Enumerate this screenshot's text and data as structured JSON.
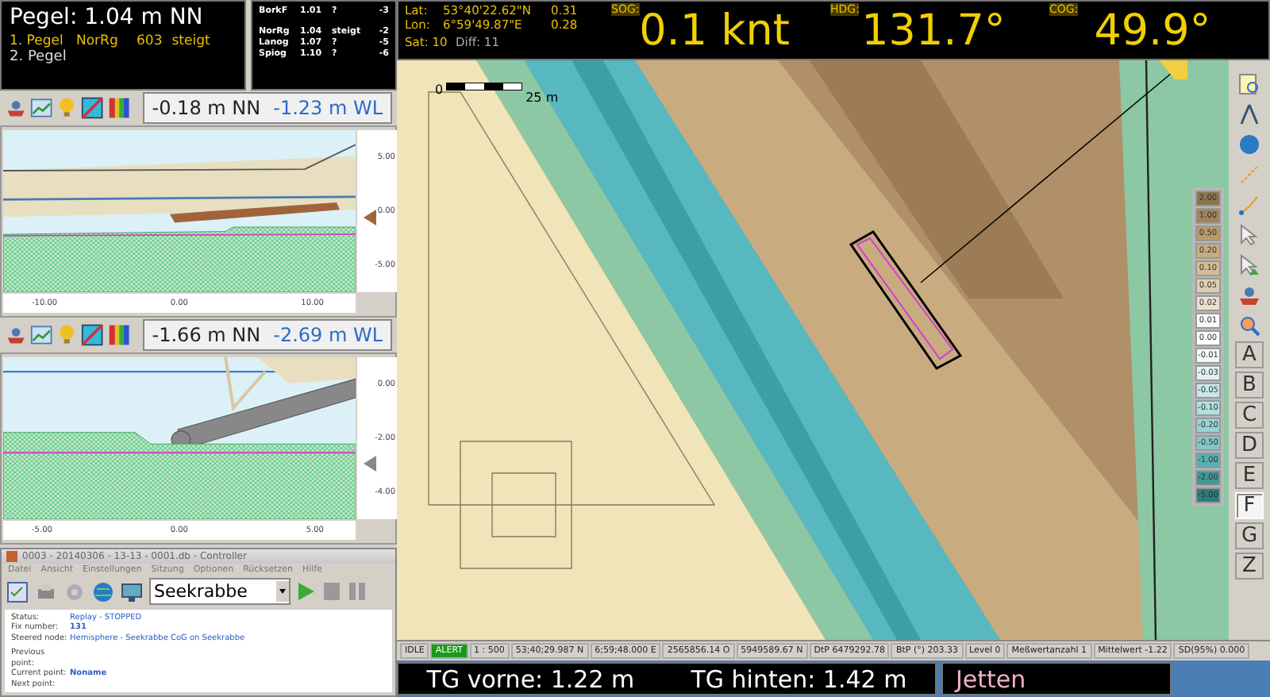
{
  "water_level": {
    "title": "Pegel: 1.04 m NN",
    "gauges": [
      {
        "label": "1. Pegel",
        "station": "NorRg",
        "value": "603",
        "trend": "steigt"
      },
      {
        "label": "2. Pegel"
      }
    ]
  },
  "gauge_groups": [
    [
      {
        "station": "BorkF",
        "level": "1.01",
        "trend": "?",
        "delta": "-3"
      }
    ],
    [
      {
        "station": "NorRg",
        "level": "1.04",
        "trend": "steigt",
        "delta": "-2"
      },
      {
        "station": "Lanog",
        "level": "1.07",
        "trend": "?",
        "delta": "-5"
      },
      {
        "station": "Spiog",
        "level": "1.10",
        "trend": "?",
        "delta": "-6"
      }
    ]
  ],
  "gps": {
    "lat_label": "Lat:",
    "lat": "53°40'22.62\"N",
    "lat_extra": "0.31",
    "lon_label": "Lon:",
    "lon": "6°59'49.87\"E",
    "lon_extra": "0.28",
    "sat": "Sat: 10",
    "diff": "Diff: 11"
  },
  "readouts": [
    {
      "label": "SOG:",
      "value": "0.1 knt"
    },
    {
      "label": "HDG:",
      "value": "131.7°"
    },
    {
      "label": "COG:",
      "value": "49.9°"
    }
  ],
  "profiles": [
    {
      "kind": "railing",
      "nn": "-0.18 m NN",
      "wl": "-1.23 m WL",
      "y_ticks": [
        "5.00",
        "0.00",
        "-5.00"
      ],
      "x_ticks": [
        "-10.00",
        "0.00",
        "10.00"
      ]
    },
    {
      "kind": "pipe",
      "nn": "-1.66 m NN",
      "wl": "-2.69 m WL",
      "y_ticks": [
        "0.00",
        "-2.00",
        "-4.00"
      ],
      "x_ticks": [
        "-5.00",
        "0.00",
        "5.00"
      ]
    }
  ],
  "controller": {
    "title": "0003 - 20140306 - 13-13 - 0001.db - Controller",
    "menu": [
      "Datei",
      "Ansicht",
      "Einstellungen",
      "Sitzung",
      "Optionen",
      "Rücksetzen",
      "Hilfe"
    ],
    "vessel": "Seekrabbe",
    "info": [
      {
        "label": "Status:",
        "value": "Replay - STOPPED"
      },
      {
        "label": "Fix number:",
        "value": "131"
      },
      {
        "label": "Steered node:",
        "value": "Hemisphere - Seekrabbe CoG on Seekrabbe"
      }
    ],
    "points": [
      {
        "label": "Previous point:"
      },
      {
        "label": "Current point:",
        "value": "Noname"
      },
      {
        "label": "Next point:"
      }
    ]
  },
  "map": {
    "scale_start": "0",
    "scale_end": "25 m"
  },
  "depth_legend": [
    {
      "value": "2.00",
      "color": "#8c7450"
    },
    {
      "value": "1.00",
      "color": "#a08458"
    },
    {
      "value": "0.50",
      "color": "#b89a68"
    },
    {
      "value": "0.20",
      "color": "#c8ac80"
    },
    {
      "value": "0.10",
      "color": "#d4bc94"
    },
    {
      "value": "0.05",
      "color": "#e0ceb0"
    },
    {
      "value": "0.02",
      "color": "#ece0cc"
    },
    {
      "value": "0.01",
      "color": "#fafafa"
    },
    {
      "value": "0.00",
      "color": "#ffffff"
    },
    {
      "value": "-0.01",
      "color": "#f4fafa"
    },
    {
      "value": "-0.03",
      "color": "#e0f2f2"
    },
    {
      "value": "-0.05",
      "color": "#c8e8e8"
    },
    {
      "value": "-0.10",
      "color": "#b0e0e0"
    },
    {
      "value": "-0.20",
      "color": "#98d4d4"
    },
    {
      "value": "-0.50",
      "color": "#80c8c8"
    },
    {
      "value": "-1.00",
      "color": "#58b0b0"
    },
    {
      "value": "-2.00",
      "color": "#409898"
    },
    {
      "value": "-5.00",
      "color": "#2c7c7c"
    }
  ],
  "letters": [
    {
      "label": "A",
      "selected": false
    },
    {
      "label": "B",
      "selected": false
    },
    {
      "label": "C",
      "selected": false
    },
    {
      "label": "D",
      "selected": false
    },
    {
      "label": "E",
      "selected": false
    },
    {
      "label": "F",
      "selected": true
    },
    {
      "label": "G",
      "selected": false
    },
    {
      "label": "Z",
      "selected": false
    }
  ],
  "status_bar": [
    {
      "text": "IDLE",
      "alert": false
    },
    {
      "text": "ALERT",
      "alert": true
    },
    {
      "text": "1 : 500",
      "alert": false
    },
    {
      "text": "53;40;29.987 N",
      "alert": false
    },
    {
      "text": "6;59;48.000 E",
      "alert": false
    },
    {
      "text": "2565856.14 O",
      "alert": false
    },
    {
      "text": "5949589.67 N",
      "alert": false
    },
    {
      "text": "DtP 6479292.78",
      "alert": false
    },
    {
      "text": "BtP (°) 203.33",
      "alert": false
    },
    {
      "text": "Level 0",
      "alert": false
    },
    {
      "text": "Meßwertanzahl  1",
      "alert": false
    },
    {
      "text": "Mittelwert -1.22",
      "alert": false
    },
    {
      "text": "SD(95%) 0.000",
      "alert": false
    }
  ],
  "bottom": {
    "front": "TG vorne: 1.22 m",
    "rear": "TG hinten: 1.42 m",
    "vessel": "Jetten"
  }
}
